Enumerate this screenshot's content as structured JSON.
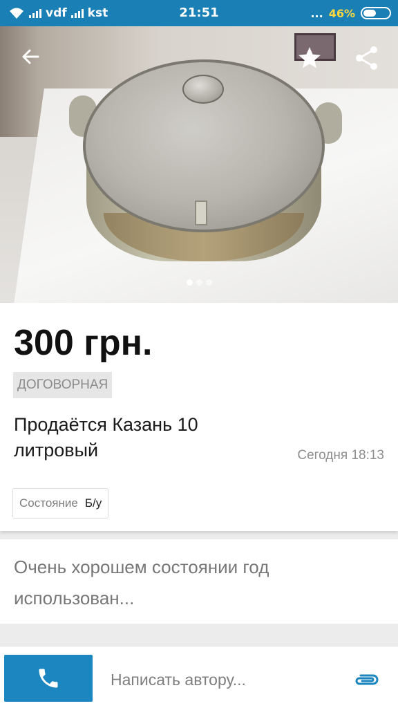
{
  "status_bar": {
    "carrier1": "vdf",
    "carrier2": "kst",
    "time": "21:51",
    "dots": "...",
    "battery_percent": "46%",
    "battery_level": 0.46,
    "icons": [
      "wifi-icon",
      "signal-icon",
      "battery-icon"
    ]
  },
  "photo": {
    "page_count": 3,
    "active_page": 1,
    "icons": [
      "back-arrow-icon",
      "star-icon",
      "share-icon"
    ]
  },
  "listing": {
    "price": "300 грн.",
    "negotiable_badge": "ДОГОВОРНАЯ",
    "title": "Продаётся Казань 10 литровый",
    "date": "Сегодня 18:13",
    "condition_label": "Состояние",
    "condition_value": "Б/у"
  },
  "description": {
    "text": "Очень хорошем состоянии год использован..."
  },
  "bottom_bar": {
    "message_placeholder": "Написать автору...",
    "icons": [
      "phone-icon",
      "paperclip-icon"
    ]
  },
  "colors": {
    "accent": "#1b86bf",
    "status_bar": "#1a7fb5",
    "battery_text": "#ffd83d"
  }
}
